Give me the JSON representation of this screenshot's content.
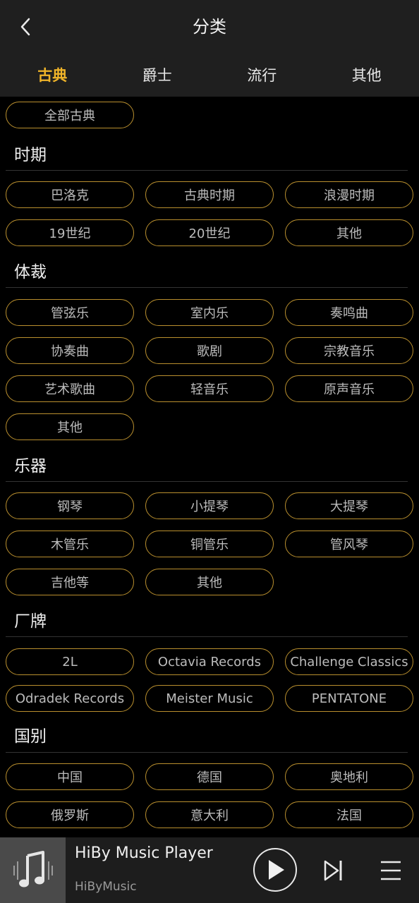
{
  "header": {
    "title": "分类",
    "back_icon": "chevron-left-icon"
  },
  "tabs": [
    {
      "label": "古典",
      "active": true
    },
    {
      "label": "爵士",
      "active": false
    },
    {
      "label": "流行",
      "active": false
    },
    {
      "label": "其他",
      "active": false
    }
  ],
  "all_chip": "全部古典",
  "sections": {
    "period": {
      "title": "时期",
      "items": [
        "巴洛克",
        "古典时期",
        "浪漫时期",
        "19世纪",
        "20世纪",
        "其他"
      ]
    },
    "genre": {
      "title": "体裁",
      "items": [
        "管弦乐",
        "室内乐",
        "奏鸣曲",
        "协奏曲",
        "歌剧",
        "宗教音乐",
        "艺术歌曲",
        "轻音乐",
        "原声音乐",
        "其他"
      ]
    },
    "instrument": {
      "title": "乐器",
      "items": [
        "钢琴",
        "小提琴",
        "大提琴",
        "木管乐",
        "铜管乐",
        "管风琴",
        "吉他等",
        "其他"
      ]
    },
    "label": {
      "title": "厂牌",
      "items": [
        "2L",
        "Octavia Records",
        "Challenge Classics",
        "Odradek Records",
        "Meister Music",
        "PENTATONE"
      ]
    },
    "country": {
      "title": "国别",
      "items": [
        "中国",
        "德国",
        "奥地利",
        "俄罗斯",
        "意大利",
        "法国"
      ]
    }
  },
  "player": {
    "title": "HiBy Music Player",
    "artist": "HiByMusic"
  },
  "colors": {
    "accent": "#f0b429",
    "chip_border": "#b98f2e",
    "bar_bg": "#1f1f1f"
  }
}
